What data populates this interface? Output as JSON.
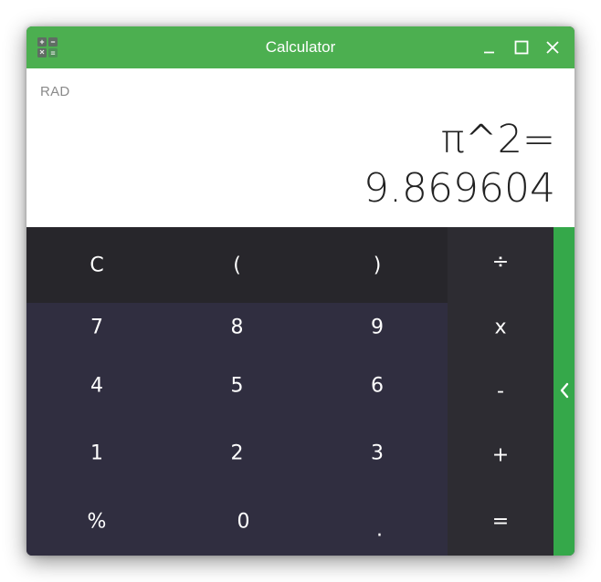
{
  "window": {
    "title": "Calculator",
    "accent_color": "#4caf50",
    "controls": {
      "minimize_icon": "minimize-icon",
      "maximize_icon": "maximize-icon",
      "close_icon": "close-icon"
    },
    "app_icon": "calculator-icon"
  },
  "display": {
    "angle_mode": "RAD",
    "expression": "π^2=",
    "result": "9.869604"
  },
  "keypad": {
    "top_row": [
      "C",
      "(",
      ")"
    ],
    "digits": [
      [
        "7",
        "8",
        "9"
      ],
      [
        "4",
        "5",
        "6"
      ],
      [
        "1",
        "2",
        "3"
      ],
      [
        "%",
        "0",
        "."
      ]
    ],
    "operators": [
      "÷",
      "x",
      "-",
      "+",
      "="
    ]
  },
  "side_panel": {
    "icon": "chevron-left-icon",
    "color": "#35a84a"
  }
}
